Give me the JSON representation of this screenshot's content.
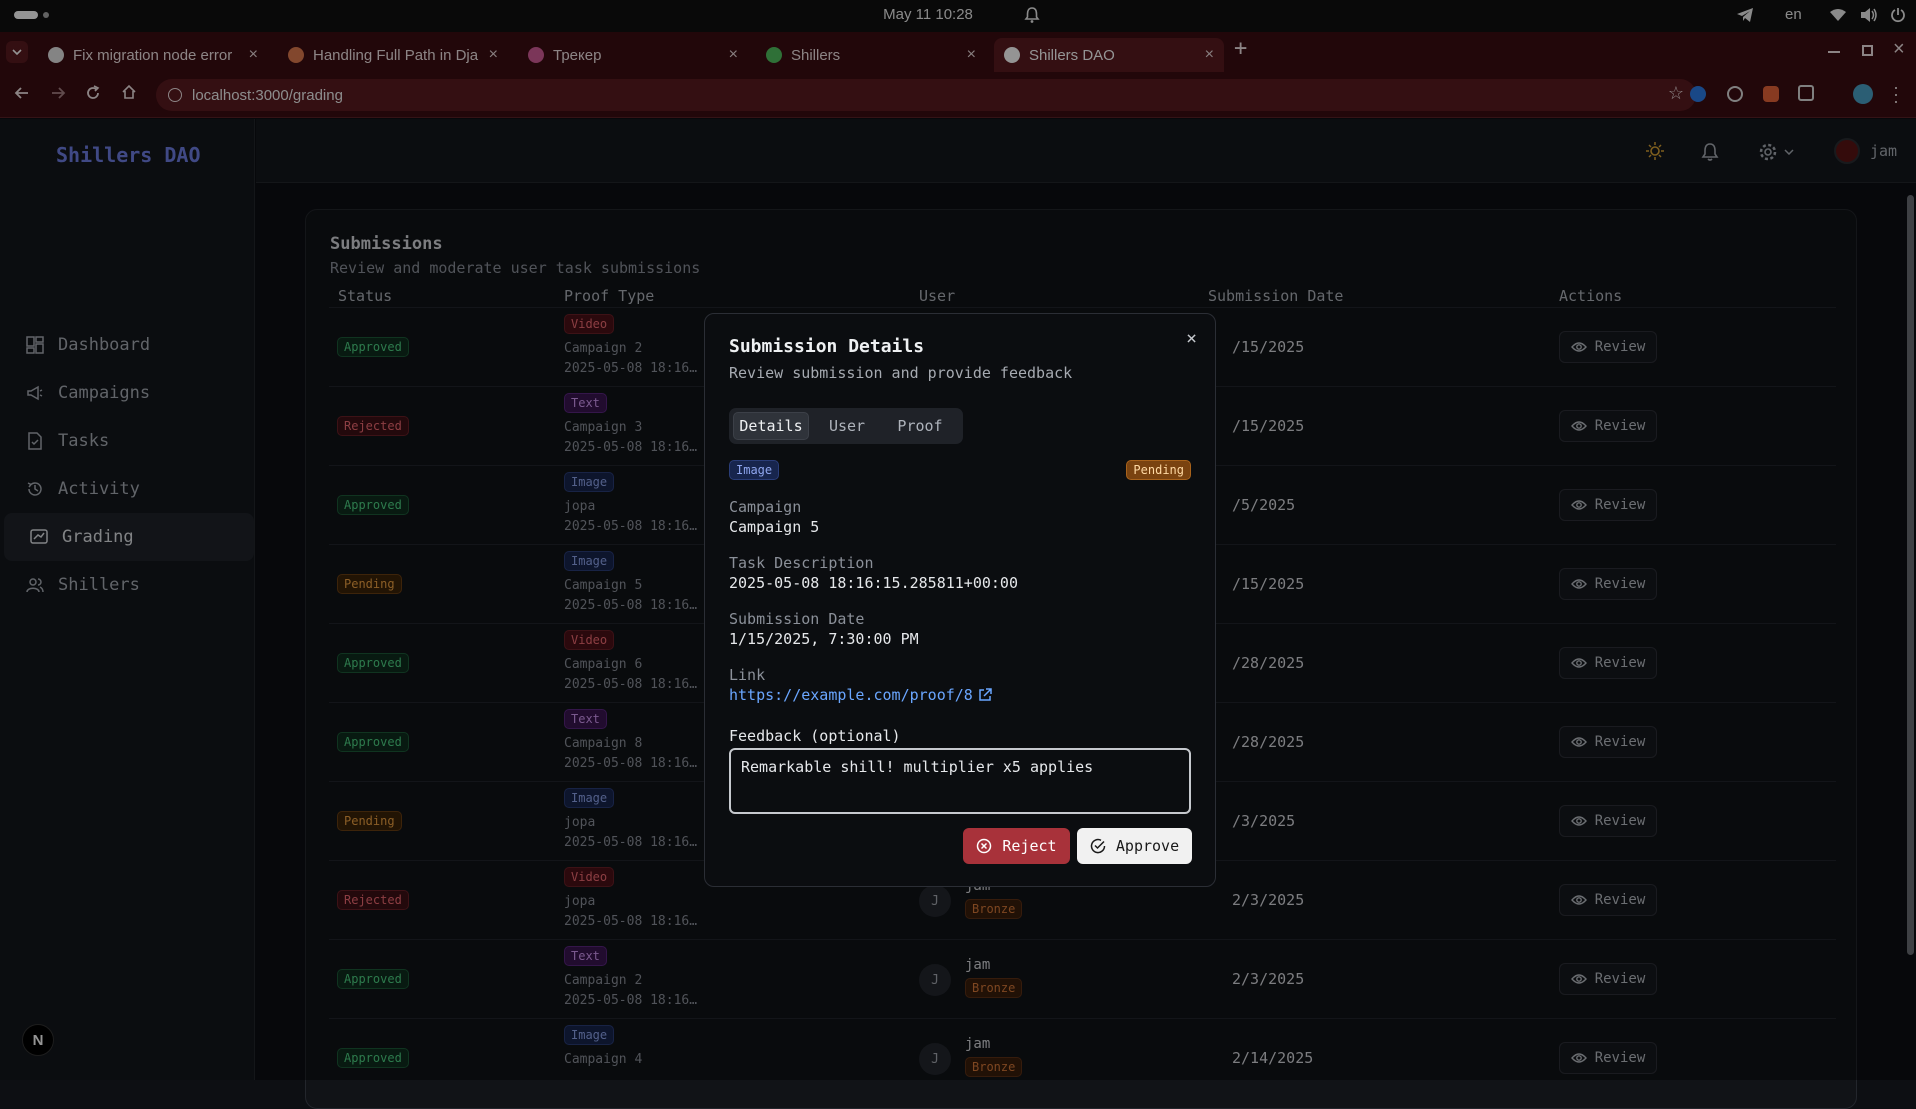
{
  "os": {
    "date_time": "May 11  10:28",
    "lang": "en"
  },
  "tabs": [
    {
      "title": "Fix migration node error",
      "color": "#e3e3e3"
    },
    {
      "title": "Handling Full Path in Dja",
      "color": "#e07a4f"
    },
    {
      "title": "Трекер",
      "color": "#d45d9a"
    },
    {
      "title": "Shillers",
      "color": "#52c15f"
    },
    {
      "title": "Shillers DAO",
      "color": "#ffffff"
    }
  ],
  "address": {
    "url": "localhost:3000/grading"
  },
  "sidebar": {
    "brand": "Shillers DAO",
    "items": [
      {
        "label": "Dashboard"
      },
      {
        "label": "Campaigns"
      },
      {
        "label": "Tasks"
      },
      {
        "label": "Activity"
      },
      {
        "label": "Grading"
      },
      {
        "label": "Shillers"
      }
    ]
  },
  "header": {
    "user": "jam"
  },
  "submissions": {
    "title": "Submissions",
    "subtitle": "Review and moderate user task submissions",
    "columns": [
      "Status",
      "Proof Type",
      "User",
      "Submission Date",
      "Actions"
    ],
    "review_label": "Review",
    "rows": [
      {
        "status": "Approved",
        "type": "Video",
        "campaign": "Campaign 2",
        "ts": "2025-05-08 18:16…",
        "date": "/15/2025",
        "user": "",
        "tier": ""
      },
      {
        "status": "Rejected",
        "type": "Text",
        "campaign": "Campaign 3",
        "ts": "2025-05-08 18:16…",
        "date": "/15/2025",
        "user": "",
        "tier": ""
      },
      {
        "status": "Approved",
        "type": "Image",
        "campaign": "jopa",
        "ts": "2025-05-08 18:16…",
        "date": "/5/2025",
        "user": "",
        "tier": ""
      },
      {
        "status": "Pending",
        "type": "Image",
        "campaign": "Campaign 5",
        "ts": "2025-05-08 18:16…",
        "date": "/15/2025",
        "user": "",
        "tier": ""
      },
      {
        "status": "Approved",
        "type": "Video",
        "campaign": "Campaign 6",
        "ts": "2025-05-08 18:16…",
        "date": "/28/2025",
        "user": "",
        "tier": ""
      },
      {
        "status": "Approved",
        "type": "Text",
        "campaign": "Campaign 8",
        "ts": "2025-05-08 18:16…",
        "date": "/28/2025",
        "user": "",
        "tier": ""
      },
      {
        "status": "Pending",
        "type": "Image",
        "campaign": "jopa",
        "ts": "2025-05-08 18:16…",
        "date": "/3/2025",
        "user": "",
        "tier": ""
      },
      {
        "status": "Rejected",
        "type": "Video",
        "campaign": "jopa",
        "ts": "2025-05-08 18:16…",
        "date": "2/3/2025",
        "user": "jam",
        "tier": "Bronze",
        "avatar": "J"
      },
      {
        "status": "Approved",
        "type": "Text",
        "campaign": "Campaign 2",
        "ts": "2025-05-08 18:16…",
        "date": "2/3/2025",
        "user": "jam",
        "tier": "Bronze",
        "avatar": "J"
      },
      {
        "status": "Approved",
        "type": "Image",
        "campaign": "Campaign 4",
        "ts": "",
        "date": "2/14/2025",
        "user": "jam",
        "tier": "Bronze",
        "avatar": "J"
      }
    ]
  },
  "modal": {
    "title": "Submission Details",
    "subtitle": "Review submission and provide feedback",
    "tabs": [
      "Details",
      "User",
      "Proof"
    ],
    "type_badge": "Image",
    "status_badge": "Pending",
    "campaign_label": "Campaign",
    "campaign_value": "Campaign 5",
    "task_label": "Task Description",
    "task_value": "2025-05-08 18:16:15.285811+00:00",
    "date_label": "Submission Date",
    "date_value": "1/15/2025, 7:30:00 PM",
    "link_label": "Link",
    "link_value": "https://example.com/proof/8",
    "feedback_label": "Feedback (optional)",
    "feedback_value": "Remarkable shill! multiplier x5 applies",
    "reject_label": "Reject",
    "approve_label": "Approve",
    "close": "×"
  }
}
